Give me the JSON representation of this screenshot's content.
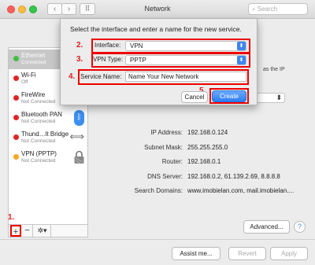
{
  "window": {
    "title": "Network",
    "search_placeholder": "Search"
  },
  "sidebar": {
    "services": [
      {
        "name": "Ethernet",
        "status": "Connected",
        "dot_color": "#3fbf3f",
        "selected": true
      },
      {
        "name": "Wi-Fi",
        "status": "Off",
        "dot_color": "#e02424"
      },
      {
        "name": "FireWire",
        "status": "Not Connected",
        "dot_color": "#e02424"
      },
      {
        "name": "Bluetooth PAN",
        "status": "Not Connected",
        "dot_color": "#e02424",
        "icon": "bluetooth-icon"
      },
      {
        "name": "Thund…lt Bridge",
        "status": "Not Connected",
        "dot_color": "#e02424",
        "icon": "bridge-icon"
      },
      {
        "name": "VPN (PPTP)",
        "status": "Not Connected",
        "dot_color": "#f5a623",
        "icon": "lock-icon"
      }
    ],
    "add_label": "+",
    "remove_label": "−",
    "gear_label": "✲▾"
  },
  "details": {
    "note": "as the IP",
    "ip_label": "IP Address:",
    "ip_value": "192.168.0.124",
    "subnet_label": "Subnet Mask:",
    "subnet_value": "255.255.255.0",
    "router_label": "Router:",
    "router_value": "192.168.0.1",
    "dns_label": "DNS Server:",
    "dns_value": "192.168.0.2, 61.139.2.69, 8.8.8.8",
    "search_label": "Search Domains:",
    "search_value": "www.imobielan.com, mail.imobielan...."
  },
  "buttons": {
    "advanced": "Advanced...",
    "help": "?",
    "assist": "Assist me...",
    "revert": "Revert",
    "apply": "Apply"
  },
  "sheet": {
    "title": "Select the interface and enter a name for the new service.",
    "interface_label": "Interface:",
    "interface_value": "VPN",
    "vpn_type_label": "VPN Type:",
    "vpn_type_value": "PPTP",
    "service_name_label": "Service Name:",
    "service_name_value": "Name Your New Network",
    "cancel": "Cancel",
    "create": "Create"
  },
  "annotations": {
    "n1": "1.",
    "n2": "2.",
    "n3": "3.",
    "n4": "4.",
    "n5": "5."
  },
  "colors": {
    "accent": "#3d84f4",
    "annotation": "#e00000"
  }
}
